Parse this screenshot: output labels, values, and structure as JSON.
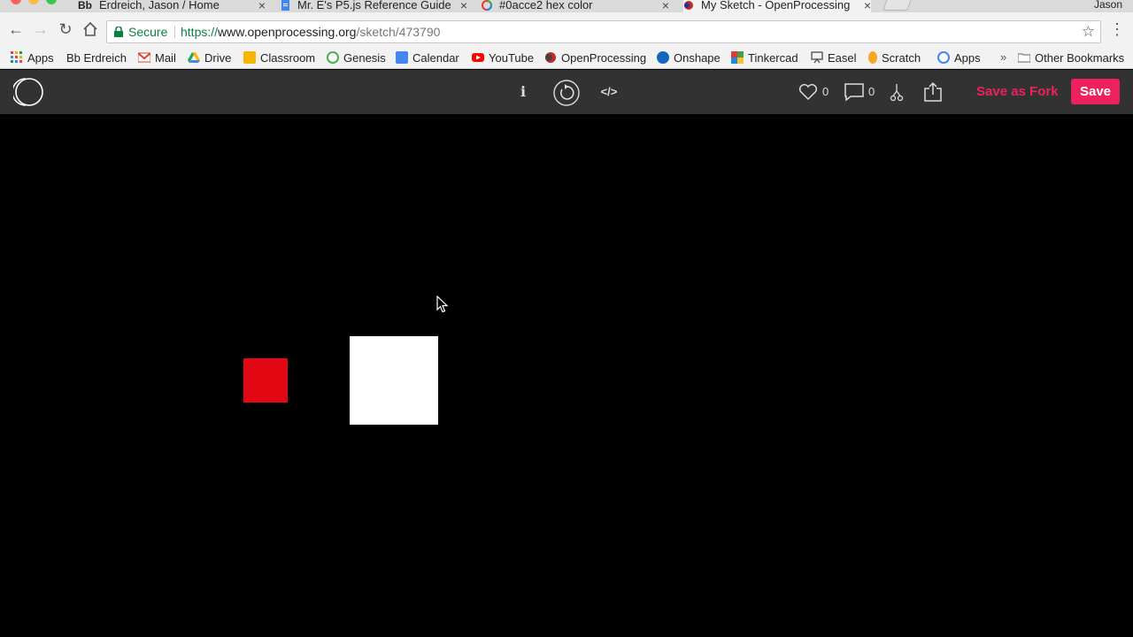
{
  "browser": {
    "tabs": [
      {
        "label": "Erdreich, Jason / Home",
        "favicon": "blackboard-icon",
        "active": false
      },
      {
        "label": "Mr. E's P5.js Reference Guide",
        "favicon": "google-docs-icon",
        "active": false
      },
      {
        "label": "#0acce2 hex color",
        "favicon": "colorhexa-icon",
        "active": false
      },
      {
        "label": "My Sketch - OpenProcessing",
        "favicon": "openprocessing-icon",
        "active": true
      }
    ],
    "profile_name": "Jason",
    "address": {
      "secure_label": "Secure",
      "scheme": "https://",
      "host": "www.openprocessing.org",
      "path": "/sketch/473790"
    },
    "bookmarks": [
      {
        "label": "Apps",
        "icon": "apps-grid-icon",
        "color": "#e8453c"
      },
      {
        "label": "Bb Erdreich",
        "icon": "blackboard-icon",
        "color": "#222222"
      },
      {
        "label": "Mail",
        "icon": "gmail-icon",
        "color": "#d44638"
      },
      {
        "label": "Drive",
        "icon": "google-drive-icon",
        "color": "#1fa463"
      },
      {
        "label": "Classroom",
        "icon": "classroom-icon",
        "color": "#f7b500"
      },
      {
        "label": "Genesis",
        "icon": "genesis-icon",
        "color": "#4caf50"
      },
      {
        "label": "Calendar",
        "icon": "calendar-icon",
        "color": "#4285f4"
      },
      {
        "label": "YouTube",
        "icon": "youtube-icon",
        "color": "#ff0000"
      },
      {
        "label": "OpenProcessing",
        "icon": "openprocessing-icon",
        "color": "#c62828"
      },
      {
        "label": "Onshape",
        "icon": "onshape-icon",
        "color": "#1565c0"
      },
      {
        "label": "Tinkercad",
        "icon": "tinkercad-icon",
        "color": "#e53935"
      },
      {
        "label": "Easel",
        "icon": "easel-icon",
        "color": "#555555"
      },
      {
        "label": "Scratch",
        "icon": "scratch-icon",
        "color": "#f9a825"
      },
      {
        "label": "Apps",
        "icon": "google-g-icon",
        "color": "#4285f4"
      }
    ],
    "bookmarks_overflow": "»",
    "other_bookmarks": "Other Bookmarks"
  },
  "op_header": {
    "info_label": "i",
    "likes_count": "0",
    "comments_count": "0",
    "save_as_fork_label": "Save as Fork",
    "save_label": "Save"
  },
  "sketch": {
    "red_square_color": "#e30613",
    "white_square_color": "#ffffff",
    "background_color": "#000000"
  },
  "colors": {
    "accent": "#ed225d",
    "header_bg": "#323232"
  }
}
